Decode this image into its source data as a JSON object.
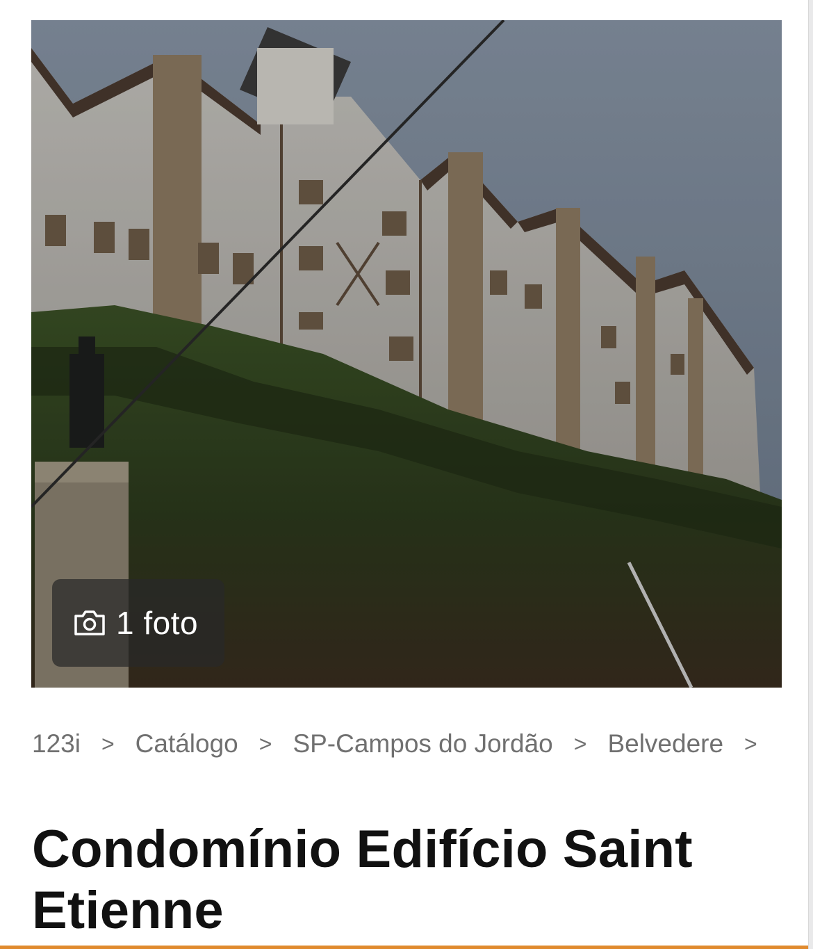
{
  "photo": {
    "count_label": "1 foto",
    "icon": "camera-icon"
  },
  "breadcrumb": {
    "items": [
      {
        "label": "123i"
      },
      {
        "label": "Catálogo"
      },
      {
        "label": "SP-Campos do Jordão"
      },
      {
        "label": "Belvedere"
      }
    ],
    "separator": ">"
  },
  "title": "Condomínio Edifício Saint Etienne",
  "colors": {
    "accent": "#e08a2e",
    "breadcrumb_text": "#707070",
    "title_text": "#111111"
  }
}
